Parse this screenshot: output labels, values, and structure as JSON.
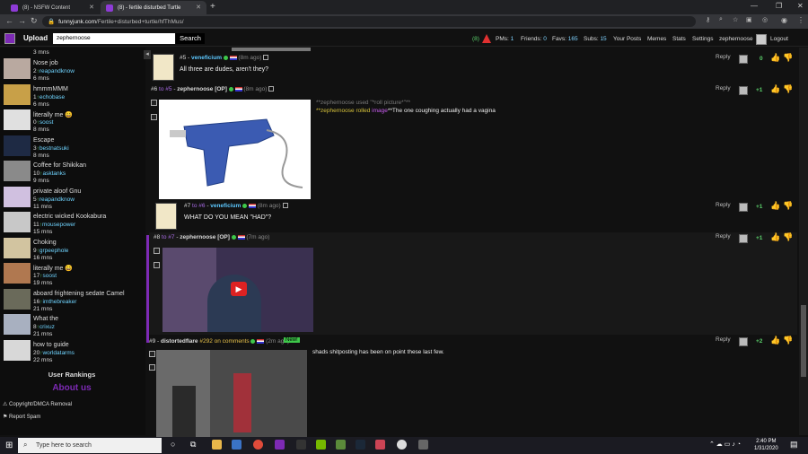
{
  "browser": {
    "tabs": [
      {
        "title": "(8) - NSFW Content"
      },
      {
        "title": "(8) - fertile disturbed Turtle"
      }
    ],
    "url_domain": "funnyjunk.com",
    "url_path": "/Fertile+disturbed+turtle/hfThMus/"
  },
  "header": {
    "upload_label": "Upload",
    "search_value": "zephernoose",
    "search_button": "Search",
    "notif_count": "(8)",
    "pms_label": "PMs:",
    "pms_value": "1",
    "friends_label": "Friends:",
    "friends_value": "0",
    "favs_label": "Favs:",
    "favs_value": "165",
    "subs_label": "Subs:",
    "subs_value": "15",
    "your_posts": "Your Posts",
    "memes": "Memes",
    "stats": "Stats",
    "settings": "Settings",
    "username": "zephernoose",
    "logout": "Logout"
  },
  "sidebar": {
    "top_partial_mins": "3 mns",
    "items": [
      {
        "title": "Nose job",
        "count": "2",
        "user": "reapandknow",
        "mins": "6 mns"
      },
      {
        "title": "hmmmMMM",
        "count": "1",
        "user": "echobase",
        "mins": "6 mns"
      },
      {
        "title": "literally me 😄",
        "count": "0",
        "user": "soost",
        "mins": "8 mns"
      },
      {
        "title": "Escape",
        "count": "3",
        "user": "bestnatsuki",
        "mins": "8 mns"
      },
      {
        "title": "Coffee for Shikikan",
        "count": "10",
        "user": "asktanks",
        "mins": "9 mns"
      },
      {
        "title": "private aloof Gnu",
        "count": "5",
        "user": "reapandknow",
        "mins": "11 mns"
      },
      {
        "title": "electric wicked Kookabura",
        "count": "11",
        "user": "mousepower",
        "mins": "15 mns"
      },
      {
        "title": "Choking",
        "count": "9",
        "user": "grpeephole",
        "mins": "16 mns"
      },
      {
        "title": "literally me 😄",
        "count": "17",
        "user": "soost",
        "mins": "19 mns"
      },
      {
        "title": "aboard frightening sedate Camel",
        "count": "16",
        "user": "imthebreaker",
        "mins": "21 mns"
      },
      {
        "title": "What the",
        "count": "8",
        "user": "crixuz",
        "mins": "21 mns"
      },
      {
        "title": "how to guide",
        "count": "20",
        "user": "worldatarms",
        "mins": "22 mns"
      }
    ],
    "user_rankings": "User Rankings",
    "about_us": "About us",
    "copyright": "Copyright/DMCA Removal",
    "report_spam": "Report Spam"
  },
  "comments": [
    {
      "num": "#5",
      "user": "veneficium",
      "time": "(8m ago)",
      "text": "All three are dudes, aren't they?",
      "reply": "Reply",
      "score": "0"
    },
    {
      "num": "#6",
      "to": "to #5",
      "user": "zephernoose [OP]",
      "time": "(8m ago)",
      "roll1": "**zephernoose used \"*roll picture*\"**",
      "roll2_user": "**zephernoose rolled ",
      "roll2_image": "image",
      "roll2_rest": "**The one coughing actually had a vagina",
      "reply": "Reply",
      "score": "+1"
    },
    {
      "num": "#7",
      "to": "to #6",
      "user": "veneficium",
      "time": "(8m ago)",
      "text": "WHAT DO YOU MEAN \"HAD\"?",
      "reply": "Reply",
      "score": "+1"
    },
    {
      "num": "#8",
      "to": "to #7",
      "user": "zephernoose [OP]",
      "time": "(7m ago)",
      "reply": "Reply",
      "score": "+1"
    },
    {
      "num": "#9",
      "user": "distortedflare",
      "badge": "#292 on comments",
      "time": "(2m ago)",
      "new": "New!",
      "text": "shads shitposting has been on point these last few.",
      "reply": "Reply",
      "score": "+2"
    }
  ],
  "taskbar": {
    "search_placeholder": "Type here to search",
    "time": "2:40 PM",
    "date": "1/31/2020"
  }
}
